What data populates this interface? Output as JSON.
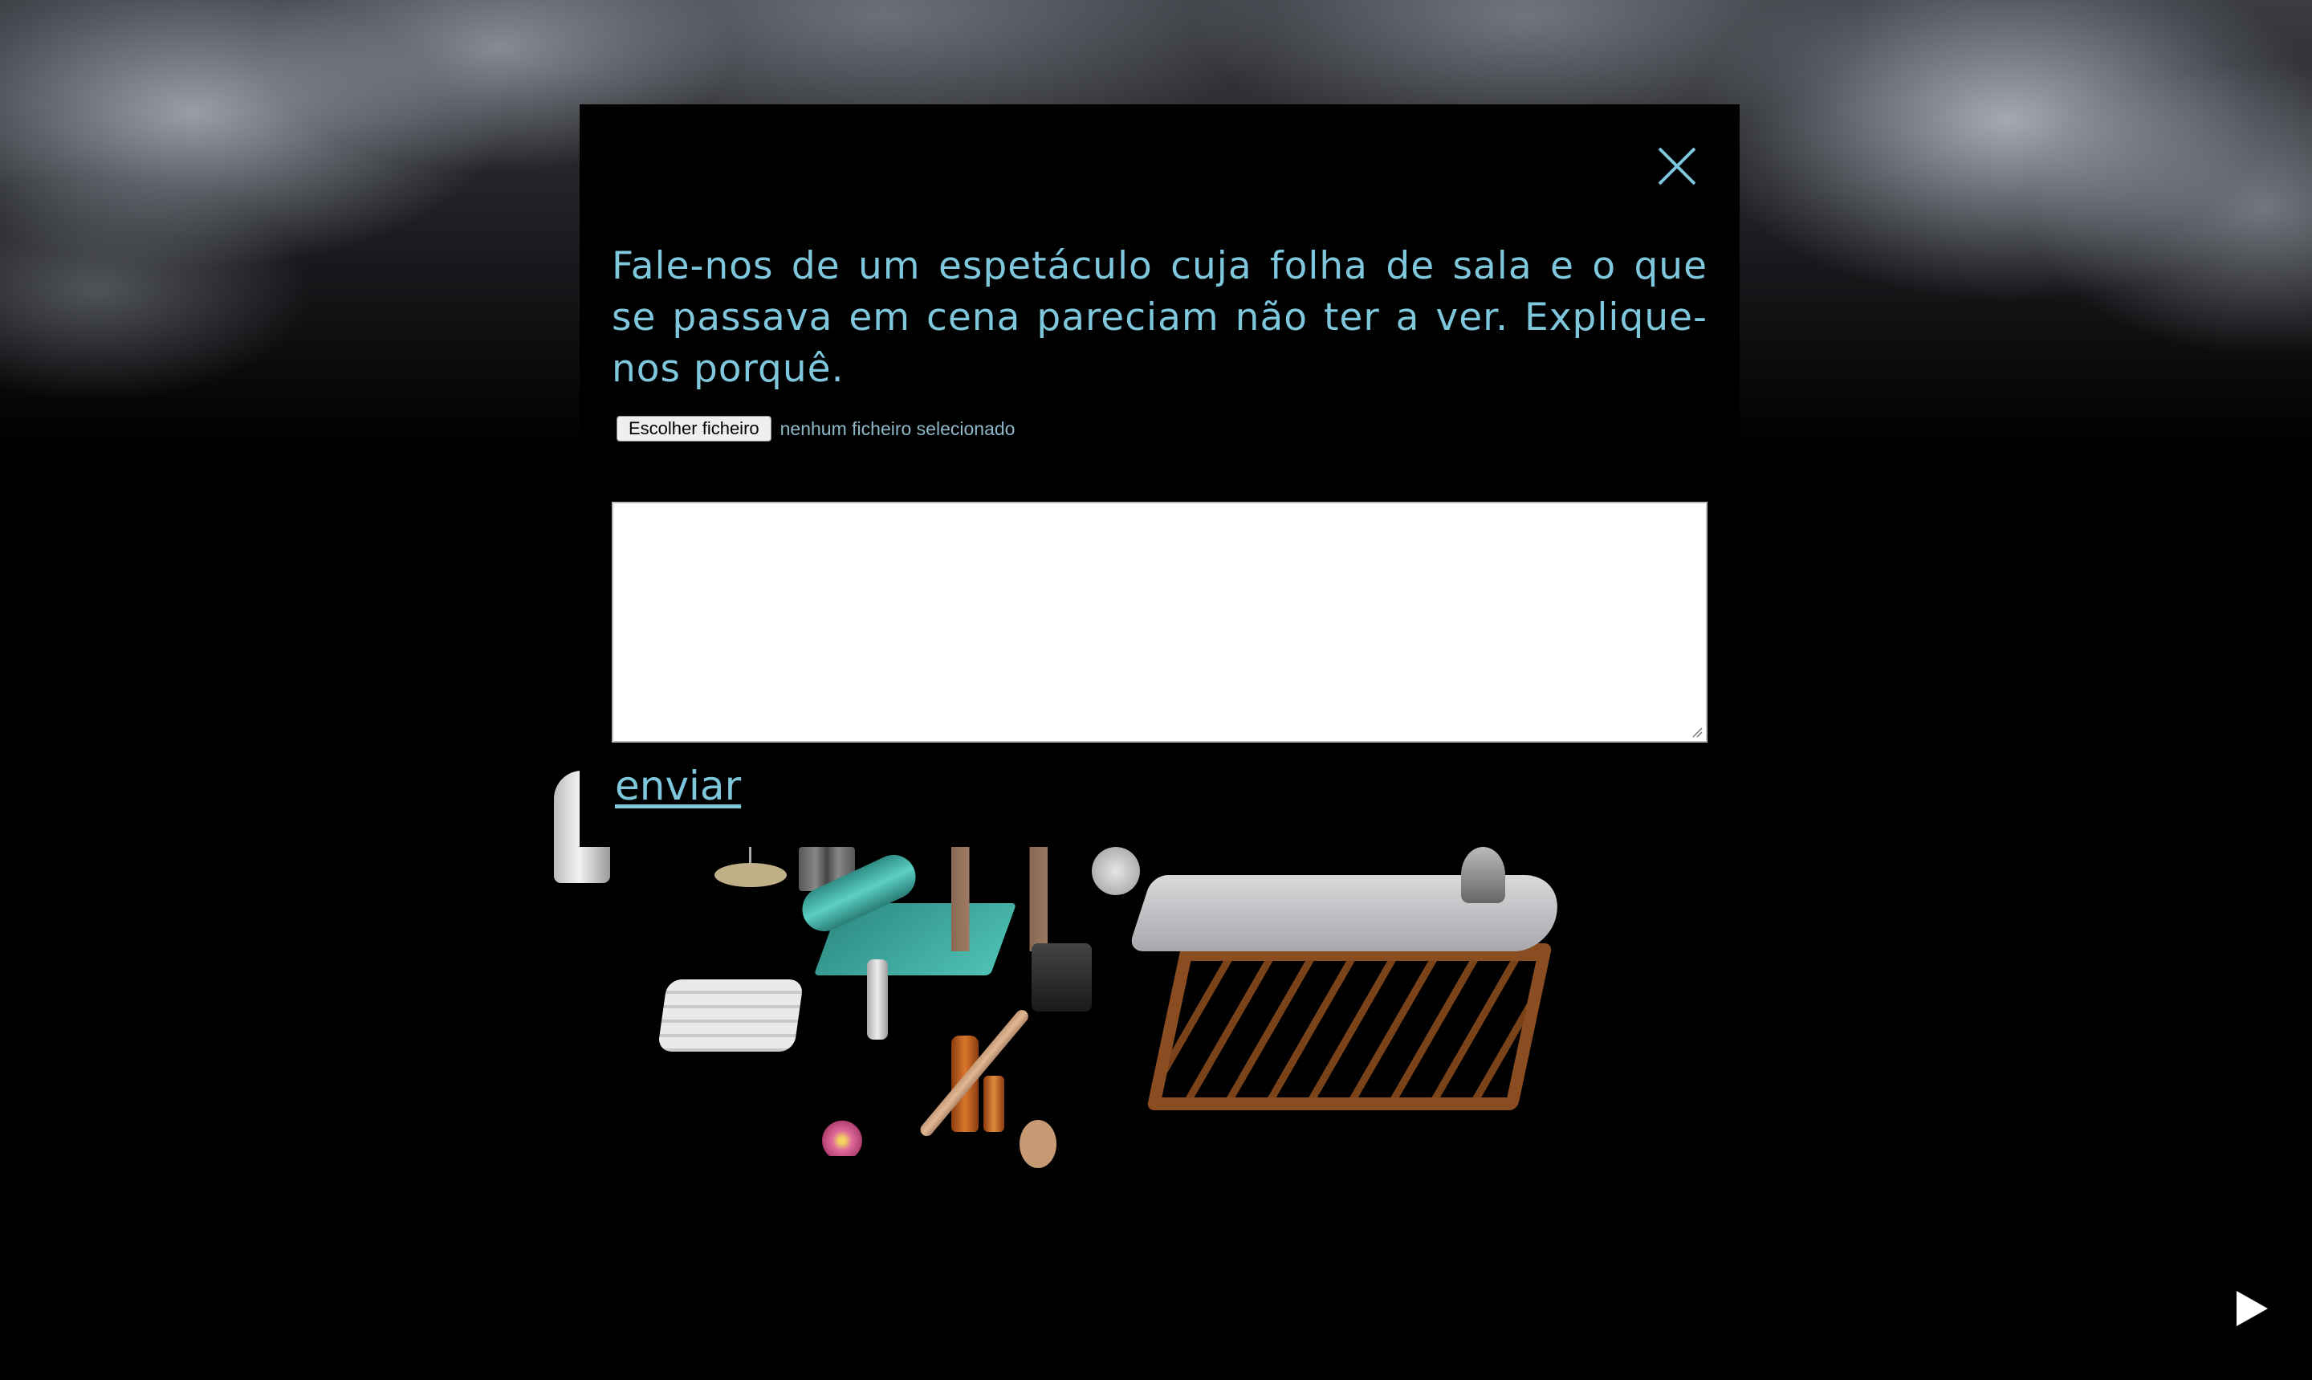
{
  "modal": {
    "prompt": "Fale-nos de um espetáculo cuja folha de sala e o que se passava em cena pareciam não ter a ver. Explique-nos porquê.",
    "file_button_label": "Escolher ficheiro",
    "file_status": "nenhum ficheiro selecionado",
    "textarea_value": "",
    "submit_label": "enviar"
  },
  "icons": {
    "close": "close-icon",
    "play": "play-icon"
  },
  "colors": {
    "accent_text": "#7fc7dc",
    "background": "#000000",
    "modal_background": "#000000"
  }
}
